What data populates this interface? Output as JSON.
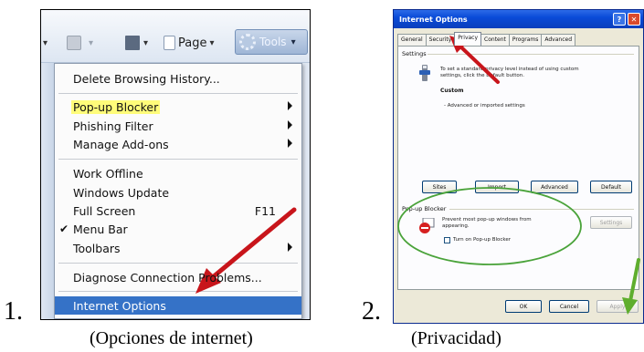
{
  "steps": [
    {
      "number": "1.",
      "caption": "(Opciones de internet)"
    },
    {
      "number": "2.",
      "caption": "(Privacidad)"
    }
  ],
  "ie_toolbar": {
    "page_label": "Page",
    "tools_label": "Tools"
  },
  "tools_menu": {
    "items": [
      {
        "label": "Delete Browsing History...",
        "submenu": false
      },
      {
        "label": "Pop-up Blocker",
        "submenu": true,
        "highlighted": true
      },
      {
        "label": "Phishing Filter",
        "submenu": true
      },
      {
        "label": "Manage Add-ons",
        "submenu": true
      },
      {
        "label": "Work Offline",
        "submenu": false
      },
      {
        "label": "Windows Update",
        "submenu": false
      },
      {
        "label": "Full Screen",
        "shortcut": "F11"
      },
      {
        "label": "Menu Bar",
        "checked": true
      },
      {
        "label": "Toolbars",
        "submenu": true
      },
      {
        "label": "Diagnose Connection Problems...",
        "submenu": false
      },
      {
        "label": "Internet Options",
        "selected": true
      }
    ]
  },
  "dialog": {
    "title": "Internet Options",
    "tabs": [
      "General",
      "Security",
      "Privacy",
      "Content",
      "Programs",
      "Advanced"
    ],
    "active_tab": "Privacy",
    "settings_group": "Settings",
    "settings_desc_1": "To set a standard privacy level instead of using custom",
    "settings_desc_2": "settings, click the Default button.",
    "custom_label": "Custom",
    "custom_desc": "- Advanced or imported settings",
    "buttons": {
      "sites": "Sites",
      "import": "Import",
      "advanced": "Advanced",
      "default": "Default"
    },
    "popup_group": "Pop-up Blocker",
    "popup_desc_1": "Prevent most pop-up windows from",
    "popup_desc_2": "appearing.",
    "popup_settings": "Settings",
    "popup_checkbox": "Turn on Pop-up Blocker",
    "ok": "OK",
    "cancel": "Cancel",
    "apply": "Apply"
  },
  "colors": {
    "annotation_arrow": "#c8151b",
    "annotation_arrow_green": "#5fae2e",
    "annotation_circle": "#4aa33a",
    "highlight": "#fffc7a",
    "selection": "#3572c7"
  }
}
